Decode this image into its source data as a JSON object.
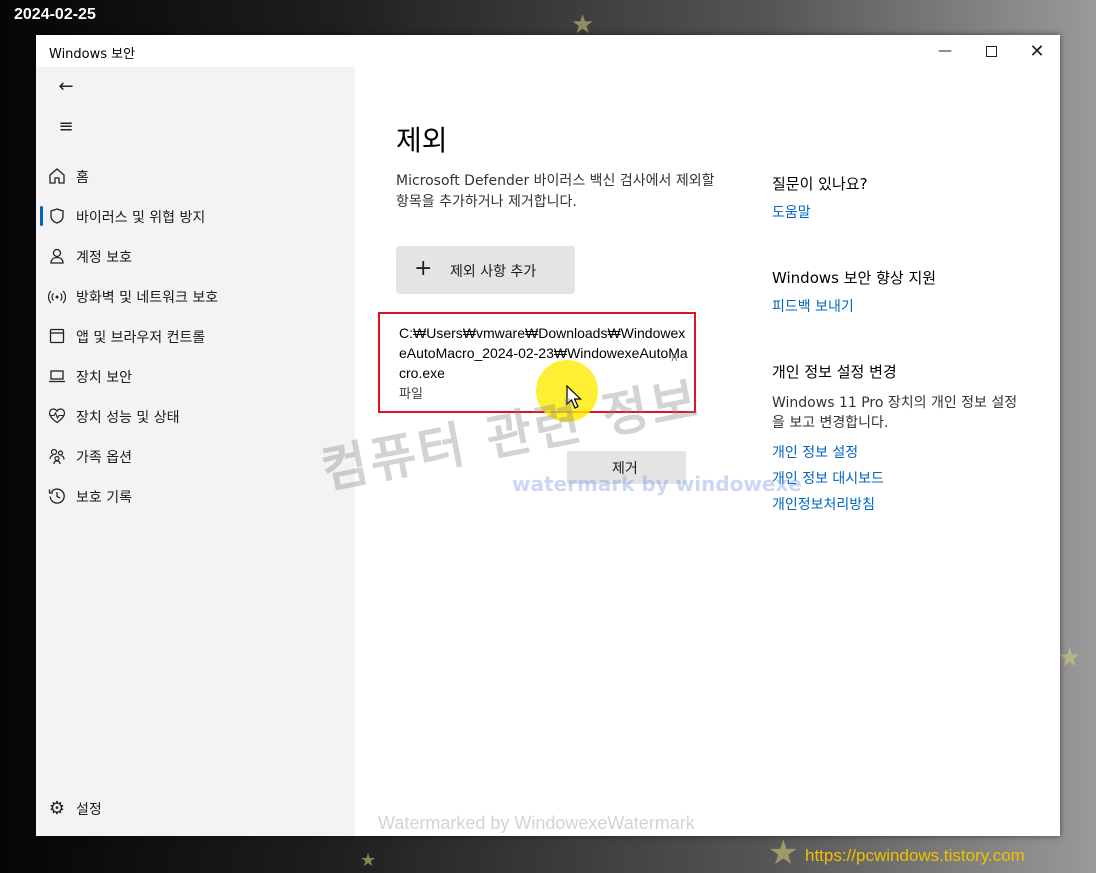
{
  "overlay": {
    "date_stamp": "2024-02-25",
    "watermark_center": "컴퓨터 관련 정보",
    "watermark_sub": "watermark by windowexe",
    "watermark_bottom": "Watermarked by WindowexeWatermark",
    "site_url": "https://pcwindows.tistory.com"
  },
  "window": {
    "title": "Windows 보안",
    "controls": [
      "minimize-icon",
      "maximize-icon",
      "close-icon"
    ]
  },
  "sidebar": {
    "back_icon": "back-arrow-icon",
    "menu_icon": "hamburger-icon",
    "items": [
      {
        "label": "홈",
        "icon": "home-icon"
      },
      {
        "label": "바이러스 및 위협 방지",
        "icon": "shield-icon",
        "active": true
      },
      {
        "label": "계정 보호",
        "icon": "person-icon"
      },
      {
        "label": "방화벽 및 네트워크 보호",
        "icon": "wifi-icon"
      },
      {
        "label": "앱 및 브라우저 컨트롤",
        "icon": "app-window-icon"
      },
      {
        "label": "장치 보안",
        "icon": "laptop-icon"
      },
      {
        "label": "장치 성능 및 상태",
        "icon": "heart-pulse-icon"
      },
      {
        "label": "가족 옵션",
        "icon": "family-icon"
      },
      {
        "label": "보호 기록",
        "icon": "history-icon"
      }
    ],
    "settings": {
      "label": "설정",
      "icon": "gear-icon"
    }
  },
  "main": {
    "title": "제외",
    "description": "Microsoft Defender 바이러스 백신 검사에서 제외할 항목을 추가하거나 제거합니다.",
    "add_button": "제외 사항 추가",
    "exclusion": {
      "path": "C:₩Users₩vmware₩Downloads₩WindowexeAutoMacro_2024-02-23₩WindowexeAutoMacro.exe",
      "type": "파일"
    },
    "remove_button": "제거"
  },
  "right_panel": {
    "question_heading": "질문이 있나요?",
    "help_link": "도움말",
    "improve_heading": "Windows 보안 향상 지원",
    "feedback_link": "피드백 보내기",
    "privacy_heading": "개인 정보 설정 변경",
    "privacy_text": "Windows 11 Pro 장치의 개인 정보 설정을 보고 변경합니다.",
    "privacy_links": [
      "개인 정보 설정",
      "개인 정보 대시보드",
      "개인정보처리방침"
    ]
  }
}
